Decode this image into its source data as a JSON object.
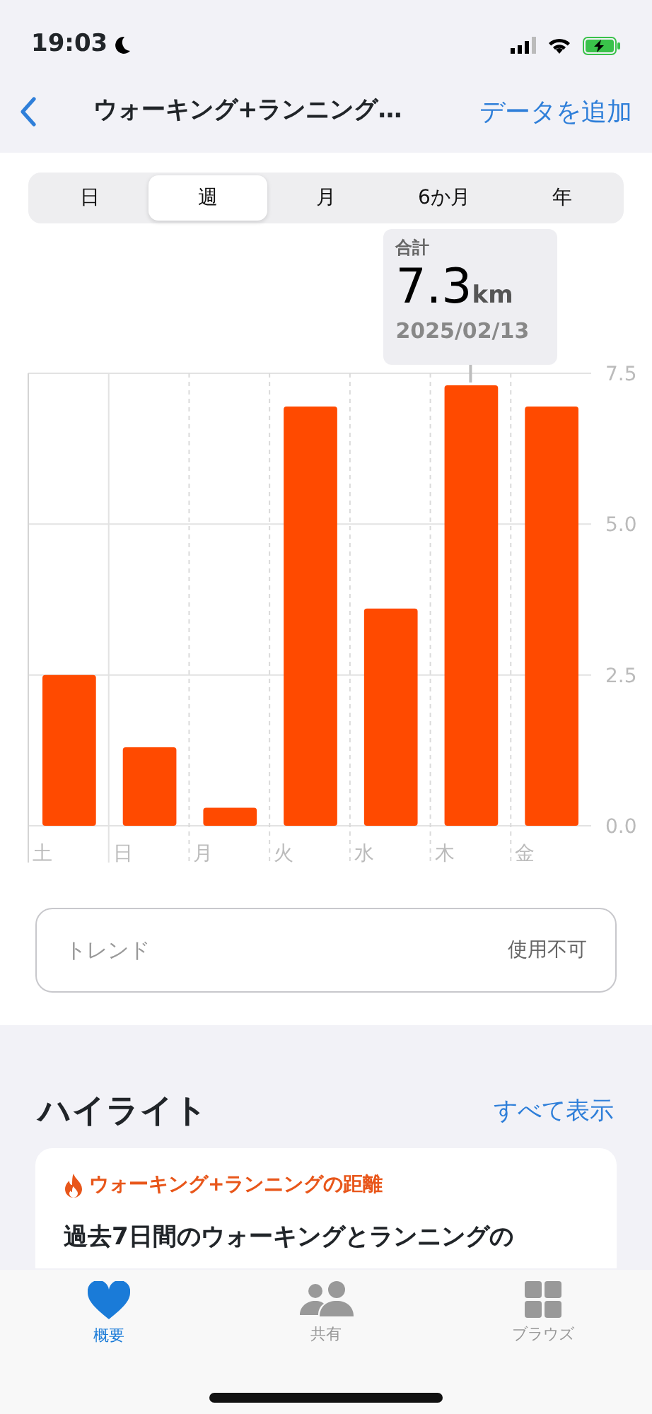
{
  "status_bar": {
    "time": "19:03"
  },
  "nav": {
    "title": "ウォーキング+ランニング…",
    "action": "データを追加"
  },
  "segments": [
    {
      "label": "日",
      "selected": false
    },
    {
      "label": "週",
      "selected": true
    },
    {
      "label": "月",
      "selected": false
    },
    {
      "label": "6か月",
      "selected": false
    },
    {
      "label": "年",
      "selected": false
    }
  ],
  "tooltip": {
    "caption": "合計",
    "value": "7.3",
    "unit": "km",
    "date": "2025/02/13"
  },
  "chart": {
    "chart_data": {
      "type": "bar",
      "categories": [
        "土",
        "日",
        "月",
        "火",
        "水",
        "木",
        "金"
      ],
      "ylim": [
        0,
        7.5
      ],
      "yticks": [
        {
          "value": 0,
          "label": "0.0"
        },
        {
          "value": 2.5,
          "label": "2.5"
        },
        {
          "value": 5,
          "label": "5.0"
        },
        {
          "value": 7.5,
          "label": "7.5"
        }
      ],
      "series": [
        {
          "color": "#ff4a00",
          "values": [
            2.5,
            1.3,
            0.3,
            6.95,
            3.6,
            7.3,
            6.95
          ]
        }
      ]
    }
  },
  "trend": {
    "label": "トレンド",
    "value": "使用不可"
  },
  "highlights": {
    "title": "ハイライト",
    "link": "すべて表示",
    "card": {
      "category": "ウォーキング+ランニングの距離",
      "text": "過去7日間のウォーキングとランニングの"
    }
  },
  "tab_bar": [
    {
      "label": "概要",
      "kind": "heart",
      "selected": true
    },
    {
      "label": "共有",
      "kind": "people",
      "selected": false
    },
    {
      "label": "ブラウズ",
      "kind": "grid",
      "selected": false
    }
  ]
}
